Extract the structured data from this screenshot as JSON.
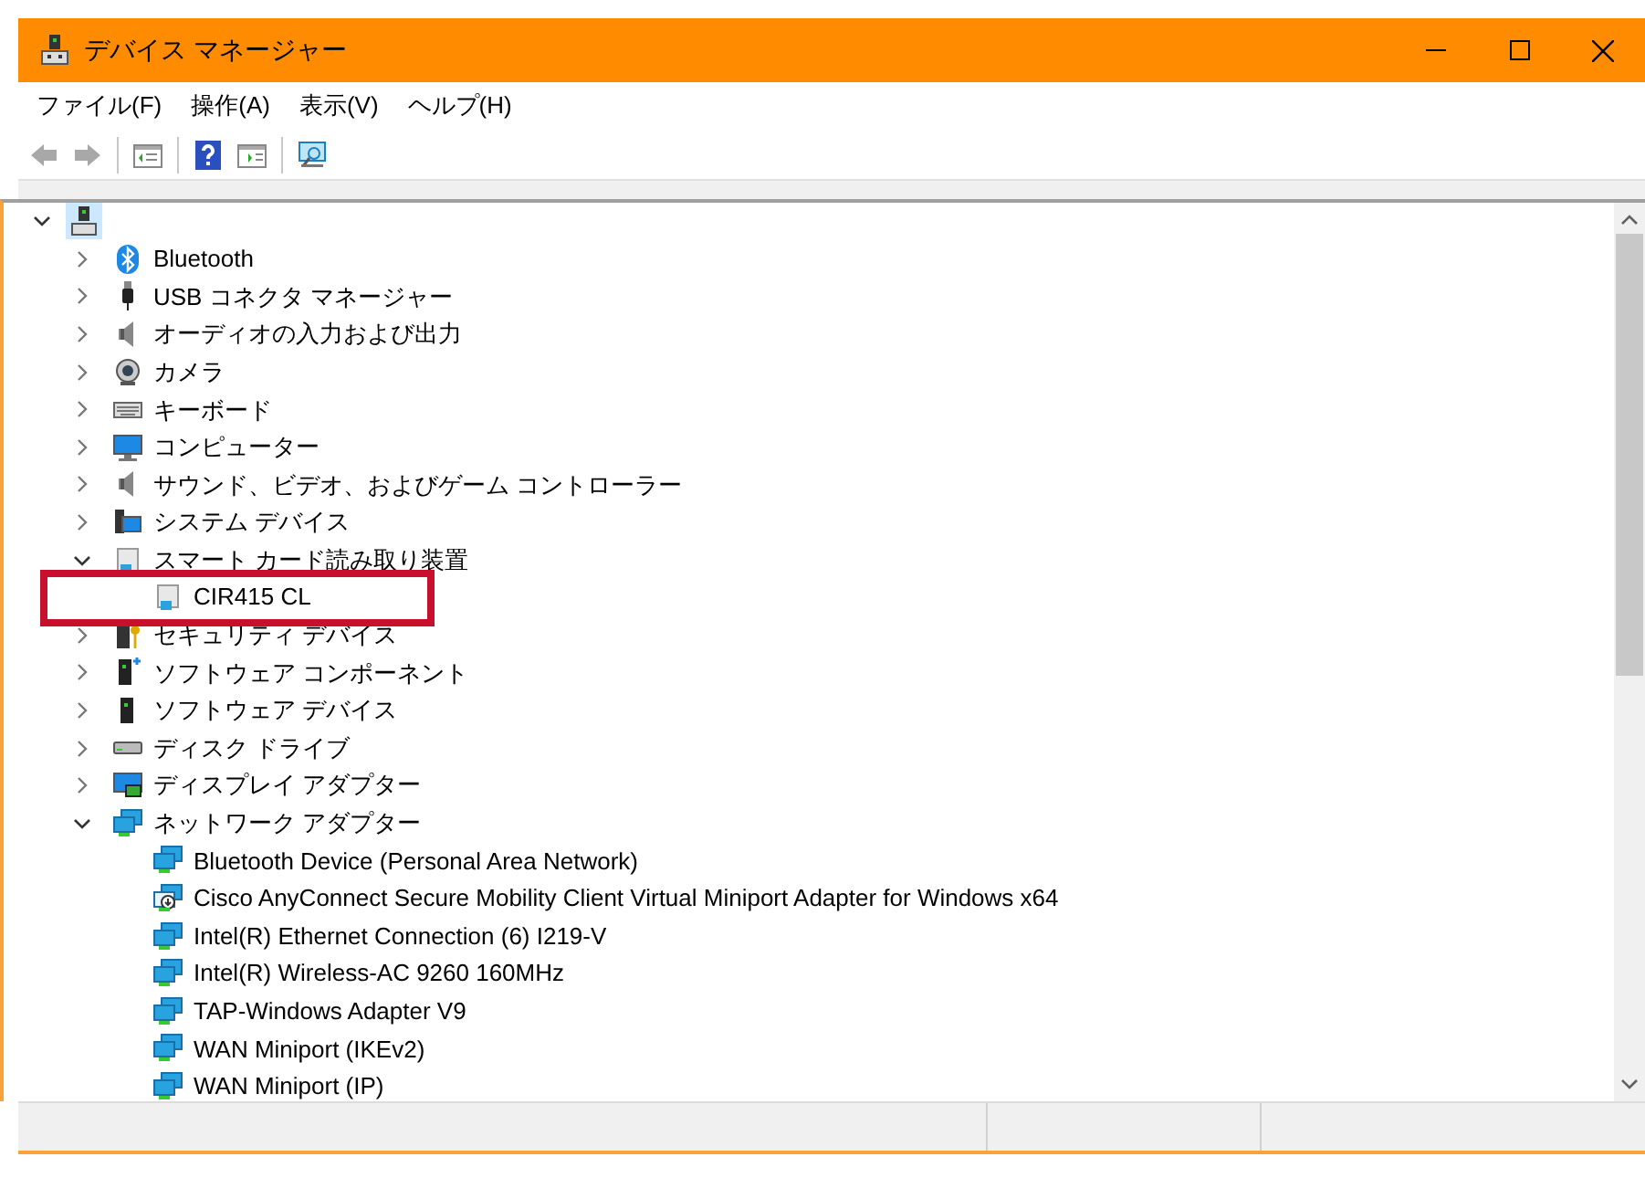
{
  "window": {
    "title": "デバイス マネージャー"
  },
  "menu": [
    "ファイル(F)",
    "操作(A)",
    "表示(V)",
    "ヘルプ(H)"
  ],
  "toolbar": [
    {
      "kind": "back",
      "disabled": true
    },
    {
      "kind": "forward",
      "disabled": true
    },
    {
      "kind": "separator"
    },
    {
      "kind": "tree-pane"
    },
    {
      "kind": "separator"
    },
    {
      "kind": "help"
    },
    {
      "kind": "action-pane"
    },
    {
      "kind": "separator"
    },
    {
      "kind": "monitor"
    }
  ],
  "tree": {
    "expanded": true,
    "selected": true,
    "children": [
      {
        "label": "Bluetooth",
        "kind": "bluetooth",
        "expanded": false
      },
      {
        "label": "USB コネクタ マネージャー",
        "kind": "usb",
        "expanded": false
      },
      {
        "label": "オーディオの入力および出力",
        "kind": "speaker",
        "expanded": false
      },
      {
        "label": "カメラ",
        "kind": "camera",
        "expanded": false
      },
      {
        "label": "キーボード",
        "kind": "keyboard",
        "expanded": false
      },
      {
        "label": "コンピューター",
        "kind": "computer",
        "expanded": false
      },
      {
        "label": "サウンド、ビデオ、およびゲーム コントローラー",
        "kind": "speaker",
        "expanded": false
      },
      {
        "label": "システム デバイス",
        "kind": "system",
        "expanded": false
      },
      {
        "label": "スマート カード読み取り装置",
        "kind": "card-reader",
        "expanded": true,
        "children": [
          {
            "label": "CIR415 CL",
            "kind": "card-reader",
            "highlighted": true
          }
        ]
      },
      {
        "label": "セキュリティ デバイス",
        "kind": "security",
        "expanded": false
      },
      {
        "label": "ソフトウェア コンポーネント",
        "kind": "software-component",
        "expanded": false
      },
      {
        "label": "ソフトウェア デバイス",
        "kind": "software-device",
        "expanded": false
      },
      {
        "label": "ディスク ドライブ",
        "kind": "disk",
        "expanded": false
      },
      {
        "label": "ディスプレイ アダプター",
        "kind": "display",
        "expanded": false
      },
      {
        "label": "ネットワーク アダプター",
        "kind": "network",
        "expanded": true,
        "children": [
          {
            "label": "Bluetooth Device (Personal Area Network)",
            "kind": "network",
            "highlighted": false
          },
          {
            "label": "Cisco AnyConnect Secure Mobility Client Virtual Miniport Adapter for Windows x64",
            "kind": "network-download",
            "highlighted": false
          },
          {
            "label": "Intel(R) Ethernet Connection (6) I219-V",
            "kind": "network",
            "highlighted": false
          },
          {
            "label": "Intel(R) Wireless-AC 9260 160MHz",
            "kind": "network",
            "highlighted": false
          },
          {
            "label": "TAP-Windows Adapter V9",
            "kind": "network",
            "highlighted": false
          },
          {
            "label": "WAN Miniport (IKEv2)",
            "kind": "network",
            "highlighted": false
          },
          {
            "label": "WAN Miniport (IP)",
            "kind": "network",
            "highlighted": false
          }
        ]
      }
    ]
  }
}
